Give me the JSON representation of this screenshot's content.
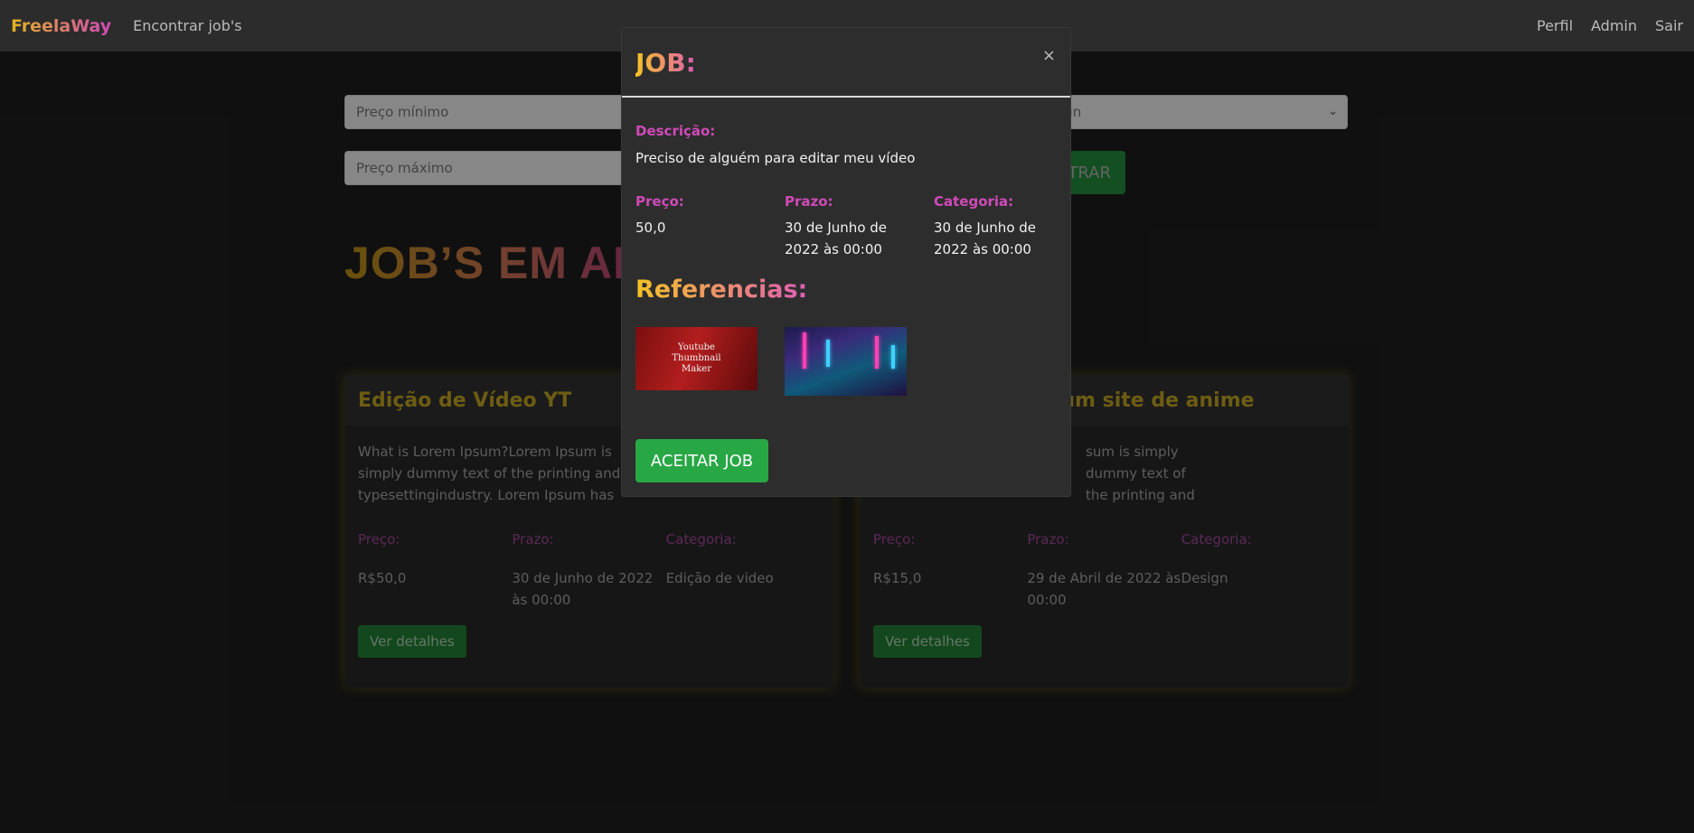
{
  "navbar": {
    "brand": "FreelaWay",
    "find_jobs": "Encontrar job's",
    "profile": "Perfil",
    "admin": "Admin",
    "logout": "Sair"
  },
  "filters": {
    "min_price_placeholder": "Preço mínimo",
    "max_price_placeholder": "Preço máximo",
    "category_selected": "ign",
    "filter_button": "TRAR"
  },
  "section_title": "JOB’S EM AI",
  "cards": [
    {
      "title": "Edição de Vídeo YT",
      "description": "What is Lorem Ipsum?Lorem Ipsum is simply dummy text of the printing and typesettingindustry. Lorem Ipsum has been",
      "price_label": "Preço:",
      "deadline_label": "Prazo:",
      "category_label": "Categoria:",
      "price": "R$50,0",
      "deadline": "30 de Junho de 2022 às 00:00",
      "category": "Edição de video",
      "button": "Ver detalhes"
    },
    {
      "title": "ra um site de anime",
      "description": "sum is simply dummy text of the printing and typesettingindustry. Lorem Ipsum has been",
      "price_label": "Preço:",
      "deadline_label": "Prazo:",
      "category_label": "Categoria:",
      "price": "R$15,0",
      "deadline": "29 de Abril de 2022 às 00:00",
      "category": "Design",
      "button": "Ver detalhes"
    }
  ],
  "modal": {
    "title": "JOB:",
    "close_symbol": "×",
    "description_label": "Descrição:",
    "description": "Preciso de alguém para editar meu vídeo",
    "price_label": "Preço:",
    "price": "50,0",
    "deadline_label": "Prazo:",
    "deadline": "30 de Junho de 2022 às 00:00",
    "category_label": "Categoria:",
    "category": "30 de Junho de 2022 às 00:00",
    "references_title": "Referencias:",
    "reference_1_text": "Youtube Thumbnail Maker",
    "accept_button": "ACEITAR JOB"
  },
  "colors": {
    "accent_gold": "#f7c325",
    "accent_pink": "#d04ab8",
    "accept_green": "#28a745"
  }
}
